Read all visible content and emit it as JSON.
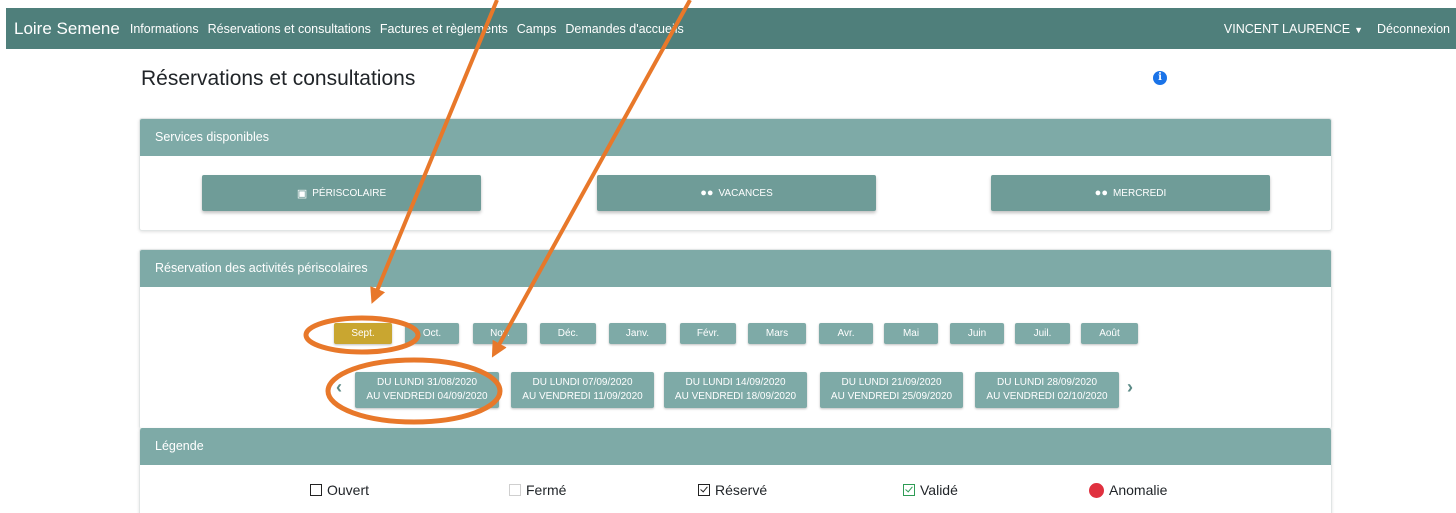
{
  "navbar": {
    "brand": "Loire Semene",
    "items": [
      "Informations",
      "Réservations et consultations",
      "Factures et règlements",
      "Camps",
      "Demandes d'accueils"
    ],
    "user": "VINCENT LAURENCE",
    "logout": "Déconnexion"
  },
  "page": {
    "title": "Réservations et consultations",
    "info_icon": "i"
  },
  "services": {
    "header": "Services disponibles",
    "buttons": [
      {
        "label": "PÉRISCOLAIRE",
        "icon": "calendar-icon"
      },
      {
        "label": "VACANCES",
        "icon": "mask-icon"
      },
      {
        "label": "MERCREDI",
        "icon": "mask-icon"
      }
    ]
  },
  "reservation": {
    "header": "Réservation des activités périscolaires",
    "months": [
      "Sept.",
      "Oct.",
      "Nov.",
      "Déc.",
      "Janv.",
      "Févr.",
      "Mars",
      "Avr.",
      "Mai",
      "Juin",
      "Juil.",
      "Août"
    ],
    "active_month": "Sept.",
    "weeks": [
      {
        "line1": "DU LUNDI 31/08/2020",
        "line2": "AU VENDREDI 04/09/2020"
      },
      {
        "line1": "DU LUNDI 07/09/2020",
        "line2": "AU VENDREDI 11/09/2020"
      },
      {
        "line1": "DU LUNDI 14/09/2020",
        "line2": "AU VENDREDI 18/09/2020"
      },
      {
        "line1": "DU LUNDI 21/09/2020",
        "line2": "AU VENDREDI 25/09/2020"
      },
      {
        "line1": "DU LUNDI 28/09/2020",
        "line2": "AU VENDREDI 02/10/2020"
      }
    ]
  },
  "legend": {
    "header": "Légende",
    "items": [
      {
        "label": "Ouvert",
        "icon": "empty-checkbox-icon"
      },
      {
        "label": "Fermé",
        "icon": "disabled-checkbox-icon"
      },
      {
        "label": "Réservé",
        "icon": "checked-checkbox-icon"
      },
      {
        "label": "Validé",
        "icon": "validated-checkbox-icon"
      },
      {
        "label": "Anomalie",
        "icon": "red-dot-icon"
      }
    ]
  },
  "colors": {
    "navbar": "#4f7f7b",
    "card_header": "#7eaaa7",
    "active_month": "#c9a630",
    "annotation": "#e8782a",
    "anomaly": "#e0313f"
  }
}
